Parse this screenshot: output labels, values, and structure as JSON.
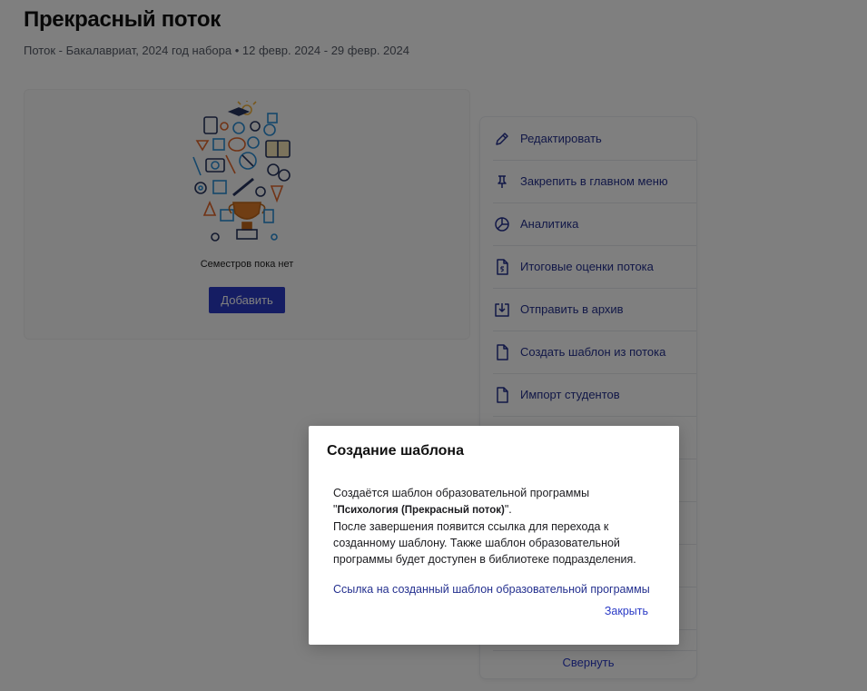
{
  "header": {
    "title": "Прекрасный поток",
    "subtitle": "Поток - Бакалавриат, 2024 год набора • 12 февр. 2024 - 29 февр. 2024"
  },
  "semesters": {
    "empty_text": "Семестров пока нет",
    "add_label": "Добавить"
  },
  "actions": {
    "items": [
      {
        "label": "Редактировать",
        "icon": "pencil-icon"
      },
      {
        "label": "Закрепить в главном меню",
        "icon": "pin-icon"
      },
      {
        "label": "Аналитика",
        "icon": "pie-chart-icon"
      },
      {
        "label": "Итоговые оценки потока",
        "icon": "grade-document-icon"
      },
      {
        "label": "Отправить в архив",
        "icon": "archive-icon"
      },
      {
        "label": "Создать шаблон из потока",
        "icon": "document-icon"
      },
      {
        "label": "Импорт студентов",
        "icon": "document-icon"
      }
    ],
    "collapse_label": "Свернуть"
  },
  "modal": {
    "title": "Создание шаблона",
    "line1": "Создаётся шаблон образовательной программы",
    "quote_open": "\"",
    "program_name": "Психология (Прекрасный поток)",
    "quote_close": "\".",
    "line3": "После завершения появится ссылка для перехода к созданному шаблону. Также шаблон образовательной программы будет доступен в библиотеке подразделения.",
    "link_label": "Ссылка на созданный шаблон образовательной программы",
    "close_label": "Закрыть"
  },
  "colors": {
    "accent": "#2b3bc6",
    "link": "#24308f",
    "overlay": "rgba(0,0,0,0.5)"
  }
}
